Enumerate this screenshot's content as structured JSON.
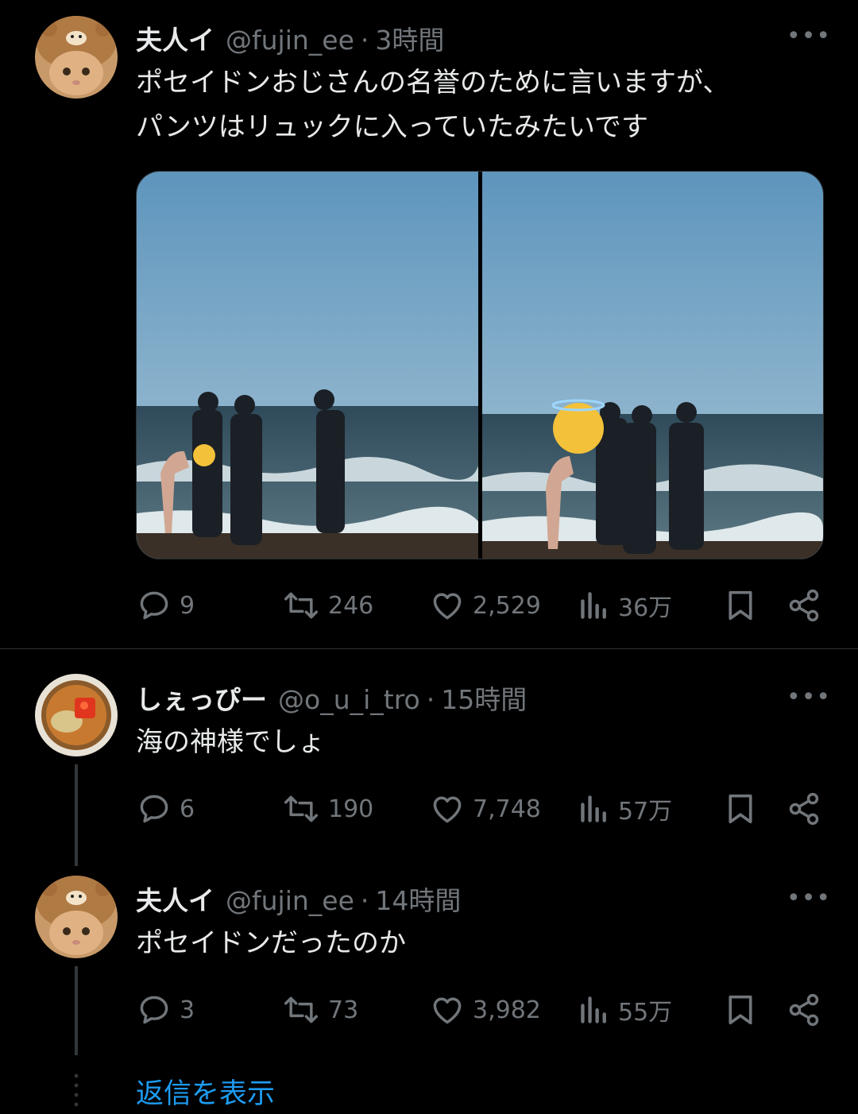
{
  "tweets": [
    {
      "name": "夫人イ",
      "handle": "@fujin_ee",
      "time": "3時間",
      "text_lines": [
        "ポセイドンおじさんの名誉のために言いますが、",
        "パンツはリュックに入っていたみたいです"
      ],
      "replies": "9",
      "retweets": "246",
      "likes": "2,529",
      "views": "36万"
    },
    {
      "name": "しぇっぴー",
      "handle": "@o_u_i_tro",
      "time": "15時間",
      "text_lines": [
        "海の神様でしょ"
      ],
      "replies": "6",
      "retweets": "190",
      "likes": "7,748",
      "views": "57万"
    },
    {
      "name": "夫人イ",
      "handle": "@fujin_ee",
      "time": "14時間",
      "text_lines": [
        "ポセイドンだったのか"
      ],
      "replies": "3",
      "retweets": "73",
      "likes": "3,982",
      "views": "55万"
    }
  ],
  "more_label": "•••",
  "separator": "·",
  "show_replies_label": "返信を表示",
  "colors": {
    "background": "#000000",
    "text": "#e7e9ea",
    "muted": "#71767b",
    "link": "#1d9bf0"
  },
  "icons": [
    "reply-icon",
    "retweet-icon",
    "like-icon",
    "views-icon",
    "bookmark-icon",
    "share-icon",
    "more-icon"
  ]
}
